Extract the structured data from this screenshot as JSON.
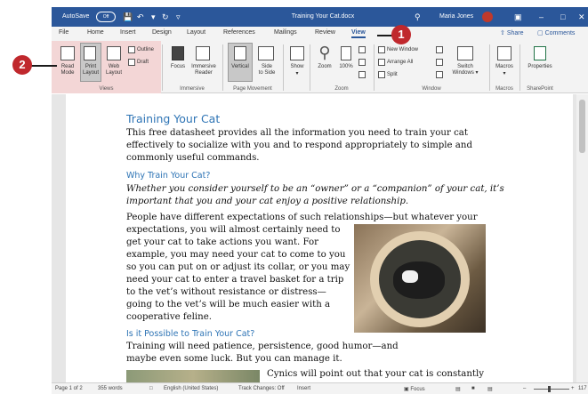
{
  "window": {
    "title": "Training Your Cat.docx",
    "autosave_label": "AutoSave",
    "autosave_state": "Off",
    "user_name": "Maria Jones"
  },
  "tabs": [
    "File",
    "Home",
    "Insert",
    "Design",
    "Layout",
    "References",
    "Mailings",
    "Review",
    "View"
  ],
  "active_tab": "View",
  "share_label": "Share",
  "comments_label": "Comments",
  "ribbon": {
    "views": {
      "read_mode": [
        "Read",
        "Mode"
      ],
      "print_layout": [
        "Print",
        "Layout"
      ],
      "web_layout": [
        "Web",
        "Layout"
      ],
      "outline": "Outline",
      "draft": "Draft",
      "group": "Views"
    },
    "immersive": {
      "focus": "Focus",
      "immersive_reader": [
        "Immersive",
        "Reader"
      ],
      "group": "Immersive"
    },
    "page_movement": {
      "vertical": "Vertical",
      "side_to_side": [
        "Side",
        "to Side"
      ],
      "group": "Page Movement"
    },
    "show": {
      "label": "Show"
    },
    "zoom": {
      "zoom": "Zoom",
      "hundred": "100%",
      "group": "Zoom"
    },
    "window": {
      "new_window": "New Window",
      "arrange_all": "Arrange All",
      "split": "Split",
      "switch_windows": [
        "Switch",
        "Windows"
      ],
      "group": "Window"
    },
    "macros": {
      "label": "Macros",
      "group": "Macros"
    },
    "sharepoint": {
      "label": "Properties",
      "group": "SharePoint"
    }
  },
  "callouts": [
    "1",
    "2"
  ],
  "document": {
    "title": "Training Your Cat",
    "intro": "This free datasheet provides all the information you need to train your cat effectively to socialize with you and to respond appropriately to simple and commonly useful commands.",
    "h2_why": "Why Train Your Cat?",
    "why_text": "Whether you consider yourself to be an “owner” or a “companion” of your cat, it’s important that you and your cat enjoy a positive relationship.",
    "expect_line1": "People have different expectations of such relationships—but whatever your",
    "expect_rest": "expectations, you will almost certainly need to get your cat to take actions you want. For example, you may need your cat to come to you so you can put on or adjust its collar, or you may need your cat to enter a travel basket for a trip to the vet’s without resistance or distress—going to the vet’s will be much easier with a cooperative feline.",
    "h2_possible": "Is it Possible to Train Your Cat?",
    "possible_text": "Training will need patience, persistence, good humor—and maybe even some luck. But you can manage it.",
    "cynics_text": "Cynics will point out that your cat is constantly"
  },
  "status": {
    "page": "Page 1 of 2",
    "words": "355 words",
    "language": "English (United States)",
    "track_changes": "Track Changes: Off",
    "insert": "Insert",
    "focus": "Focus",
    "zoom_level": "117"
  }
}
